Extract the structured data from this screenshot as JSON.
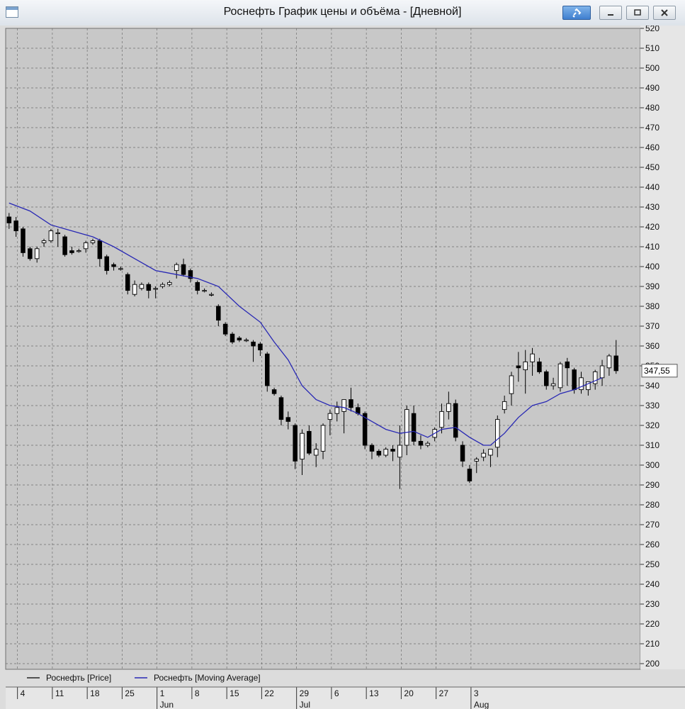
{
  "window": {
    "title": "Роснефть График цены и объёма - [Дневной]"
  },
  "controls": {
    "link_icon": "link-icon",
    "minimize": "minimize-icon",
    "maximize": "maximize-icon",
    "close": "close-icon"
  },
  "chart_data": {
    "type": "candlestick",
    "yticks": [
      520,
      510,
      500,
      490,
      480,
      470,
      460,
      450,
      440,
      430,
      420,
      410,
      400,
      390,
      380,
      370,
      360,
      350,
      340,
      330,
      320,
      310,
      300,
      290,
      280,
      270,
      260,
      250,
      240,
      230,
      220,
      210,
      200
    ],
    "ylim": [
      197,
      523
    ],
    "last_price_label": "347,55",
    "last_price": 347.55,
    "grid": true,
    "legend_position": "bottom-left",
    "legend": [
      "Роснефть [Price]",
      "Роснефть [Moving Average]"
    ],
    "colors": {
      "background": "#c8c8c8",
      "grid": "#6f6f6f",
      "price": "#000000",
      "moving_average": "#2828b4",
      "bull_fill": "#ffffff",
      "bear_fill": "#000000"
    },
    "x_ticks": [
      {
        "i": 1,
        "label": "4"
      },
      {
        "i": 6,
        "label": "11"
      },
      {
        "i": 11,
        "label": "18"
      },
      {
        "i": 16,
        "label": "25"
      },
      {
        "i": 21,
        "label": "1"
      },
      {
        "i": 26,
        "label": "8"
      },
      {
        "i": 31,
        "label": "15"
      },
      {
        "i": 36,
        "label": "22"
      },
      {
        "i": 41,
        "label": "29"
      },
      {
        "i": 46,
        "label": "6"
      },
      {
        "i": 51,
        "label": "13"
      },
      {
        "i": 56,
        "label": "20"
      },
      {
        "i": 61,
        "label": "27"
      },
      {
        "i": 66,
        "label": "3"
      }
    ],
    "month_labels": [
      {
        "i": 21,
        "label": "Jun"
      },
      {
        "i": 41,
        "label": "Jul"
      },
      {
        "i": 66,
        "label": "Aug"
      }
    ],
    "candles": [
      [
        425,
        427,
        419,
        422
      ],
      [
        423,
        425,
        415,
        418
      ],
      [
        419,
        420,
        405,
        407
      ],
      [
        409,
        410,
        403,
        404
      ],
      [
        404,
        410,
        402,
        409
      ],
      [
        412,
        414,
        410,
        413
      ],
      [
        413,
        419,
        412,
        418
      ],
      [
        417,
        419,
        410,
        417
      ],
      [
        415,
        416,
        405,
        406
      ],
      [
        408,
        410,
        406,
        407
      ],
      [
        408,
        409,
        407,
        408
      ],
      [
        409,
        413,
        407,
        412
      ],
      [
        412,
        414,
        411,
        413
      ],
      [
        413,
        414,
        400,
        404
      ],
      [
        405,
        406,
        396,
        398
      ],
      [
        401,
        402,
        398,
        400
      ],
      [
        399,
        400,
        398,
        399
      ],
      [
        396,
        397,
        386,
        388
      ],
      [
        386,
        393,
        385,
        391
      ],
      [
        389,
        392,
        388,
        391
      ],
      [
        391,
        392,
        384,
        388
      ],
      [
        389,
        390,
        384,
        389
      ],
      [
        390,
        392,
        389,
        391
      ],
      [
        391,
        393,
        390,
        392
      ],
      [
        398,
        402,
        394,
        401
      ],
      [
        401,
        404,
        395,
        396
      ],
      [
        398,
        399,
        392,
        394
      ],
      [
        392,
        393,
        386,
        388
      ],
      [
        388,
        389,
        387,
        388
      ],
      [
        386,
        387,
        385,
        386
      ],
      [
        380,
        381,
        370,
        373
      ],
      [
        371,
        372,
        365,
        366
      ],
      [
        366,
        367,
        361,
        362
      ],
      [
        364,
        365,
        362,
        363
      ],
      [
        363,
        364,
        362,
        363
      ],
      [
        362,
        363,
        352,
        360
      ],
      [
        361,
        362,
        355,
        358
      ],
      [
        356,
        357,
        337,
        340
      ],
      [
        338,
        339,
        335,
        336
      ],
      [
        334,
        335,
        320,
        323
      ],
      [
        324,
        327,
        318,
        322
      ],
      [
        320,
        321,
        298,
        302
      ],
      [
        303,
        318,
        295,
        316
      ],
      [
        317,
        320,
        305,
        306
      ],
      [
        305,
        311,
        299,
        308
      ],
      [
        307,
        321,
        303,
        320
      ],
      [
        323,
        328,
        315,
        326
      ],
      [
        326,
        332,
        322,
        329
      ],
      [
        327,
        333,
        316,
        333
      ],
      [
        333,
        339,
        327,
        329
      ],
      [
        329,
        331,
        325,
        326
      ],
      [
        326,
        327,
        308,
        310
      ],
      [
        310,
        311,
        303,
        307
      ],
      [
        307,
        308,
        304,
        305
      ],
      [
        305,
        309,
        304,
        308
      ],
      [
        308,
        310,
        302,
        307
      ],
      [
        304,
        320,
        288,
        310
      ],
      [
        310,
        330,
        305,
        328
      ],
      [
        326,
        330,
        310,
        312
      ],
      [
        312,
        315,
        308,
        310
      ],
      [
        310,
        312,
        309,
        311
      ],
      [
        314,
        319,
        312,
        318
      ],
      [
        319,
        331,
        316,
        327
      ],
      [
        327,
        337,
        323,
        331
      ],
      [
        331,
        333,
        312,
        314
      ],
      [
        310,
        312,
        299,
        302
      ],
      [
        298,
        300,
        291,
        292
      ],
      [
        302,
        304,
        296,
        303
      ],
      [
        304,
        308,
        302,
        306
      ],
      [
        305,
        308,
        299,
        308
      ],
      [
        309,
        325,
        304,
        323
      ],
      [
        328,
        335,
        326,
        332
      ],
      [
        336,
        347,
        330,
        345
      ],
      [
        350,
        357,
        342,
        349
      ],
      [
        348,
        358,
        336,
        352
      ],
      [
        352,
        359,
        345,
        356
      ],
      [
        352,
        354,
        346,
        347
      ],
      [
        347,
        348,
        338,
        340
      ],
      [
        340,
        344,
        338,
        341
      ],
      [
        339,
        352,
        337,
        351
      ],
      [
        352,
        354,
        340,
        349
      ],
      [
        348,
        349,
        336,
        338
      ],
      [
        338,
        347,
        336,
        344
      ],
      [
        338,
        342,
        335,
        342
      ],
      [
        341,
        348,
        338,
        347
      ],
      [
        344,
        353,
        340,
        350
      ],
      [
        349,
        356,
        345,
        355
      ],
      [
        355,
        363,
        346,
        347.55
      ]
    ],
    "moving_average": [
      [
        0,
        432
      ],
      [
        3,
        428
      ],
      [
        6,
        421
      ],
      [
        9,
        418
      ],
      [
        12,
        415
      ],
      [
        15,
        410
      ],
      [
        18,
        404
      ],
      [
        21,
        398
      ],
      [
        24,
        396
      ],
      [
        27,
        394
      ],
      [
        30,
        390
      ],
      [
        33,
        380
      ],
      [
        36,
        372
      ],
      [
        38,
        362
      ],
      [
        40,
        353
      ],
      [
        42,
        340
      ],
      [
        44,
        333
      ],
      [
        46,
        330
      ],
      [
        48,
        329
      ],
      [
        50,
        326
      ],
      [
        52,
        322
      ],
      [
        54,
        318
      ],
      [
        56,
        316
      ],
      [
        58,
        317
      ],
      [
        60,
        314
      ],
      [
        62,
        318
      ],
      [
        64,
        319
      ],
      [
        66,
        314
      ],
      [
        68,
        310
      ],
      [
        69,
        310
      ],
      [
        71,
        316
      ],
      [
        73,
        324
      ],
      [
        75,
        330
      ],
      [
        77,
        332
      ],
      [
        79,
        336
      ],
      [
        81,
        338
      ],
      [
        83,
        341
      ],
      [
        85,
        344
      ]
    ]
  }
}
